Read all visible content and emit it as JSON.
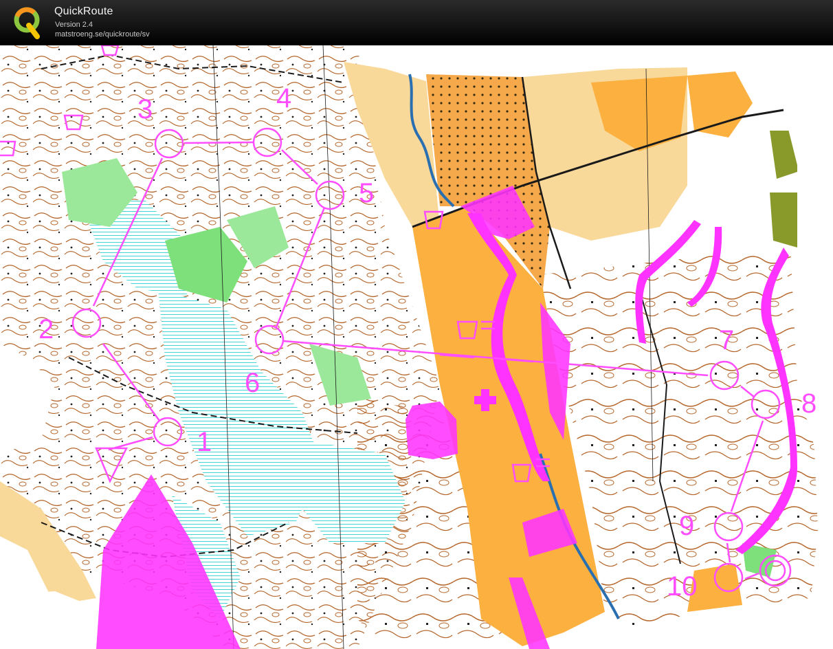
{
  "app": {
    "title": "QuickRoute",
    "version": "Version 2.4",
    "url": "matstroeng.se/quickroute/sv"
  },
  "icons": {
    "logo": "quickroute-q-logo",
    "start": "start-triangle",
    "finish": "finish-double-circle",
    "refreshment": "refreshment-cup",
    "first_aid": "first-aid-cross"
  },
  "colors": {
    "course": "#ff4dff",
    "forbidden": "#ff33ff",
    "open_land": "#fbb040",
    "rough_open": "#f9d99a",
    "forest_green": "#7de07a",
    "marsh": "#2ad0d0",
    "contour": "#b4652a"
  },
  "course": {
    "controls": [
      {
        "label": "1"
      },
      {
        "label": "2"
      },
      {
        "label": "3"
      },
      {
        "label": "4"
      },
      {
        "label": "5"
      },
      {
        "label": "6"
      },
      {
        "label": "7"
      },
      {
        "label": "8"
      },
      {
        "label": "9"
      },
      {
        "label": "10"
      }
    ]
  }
}
